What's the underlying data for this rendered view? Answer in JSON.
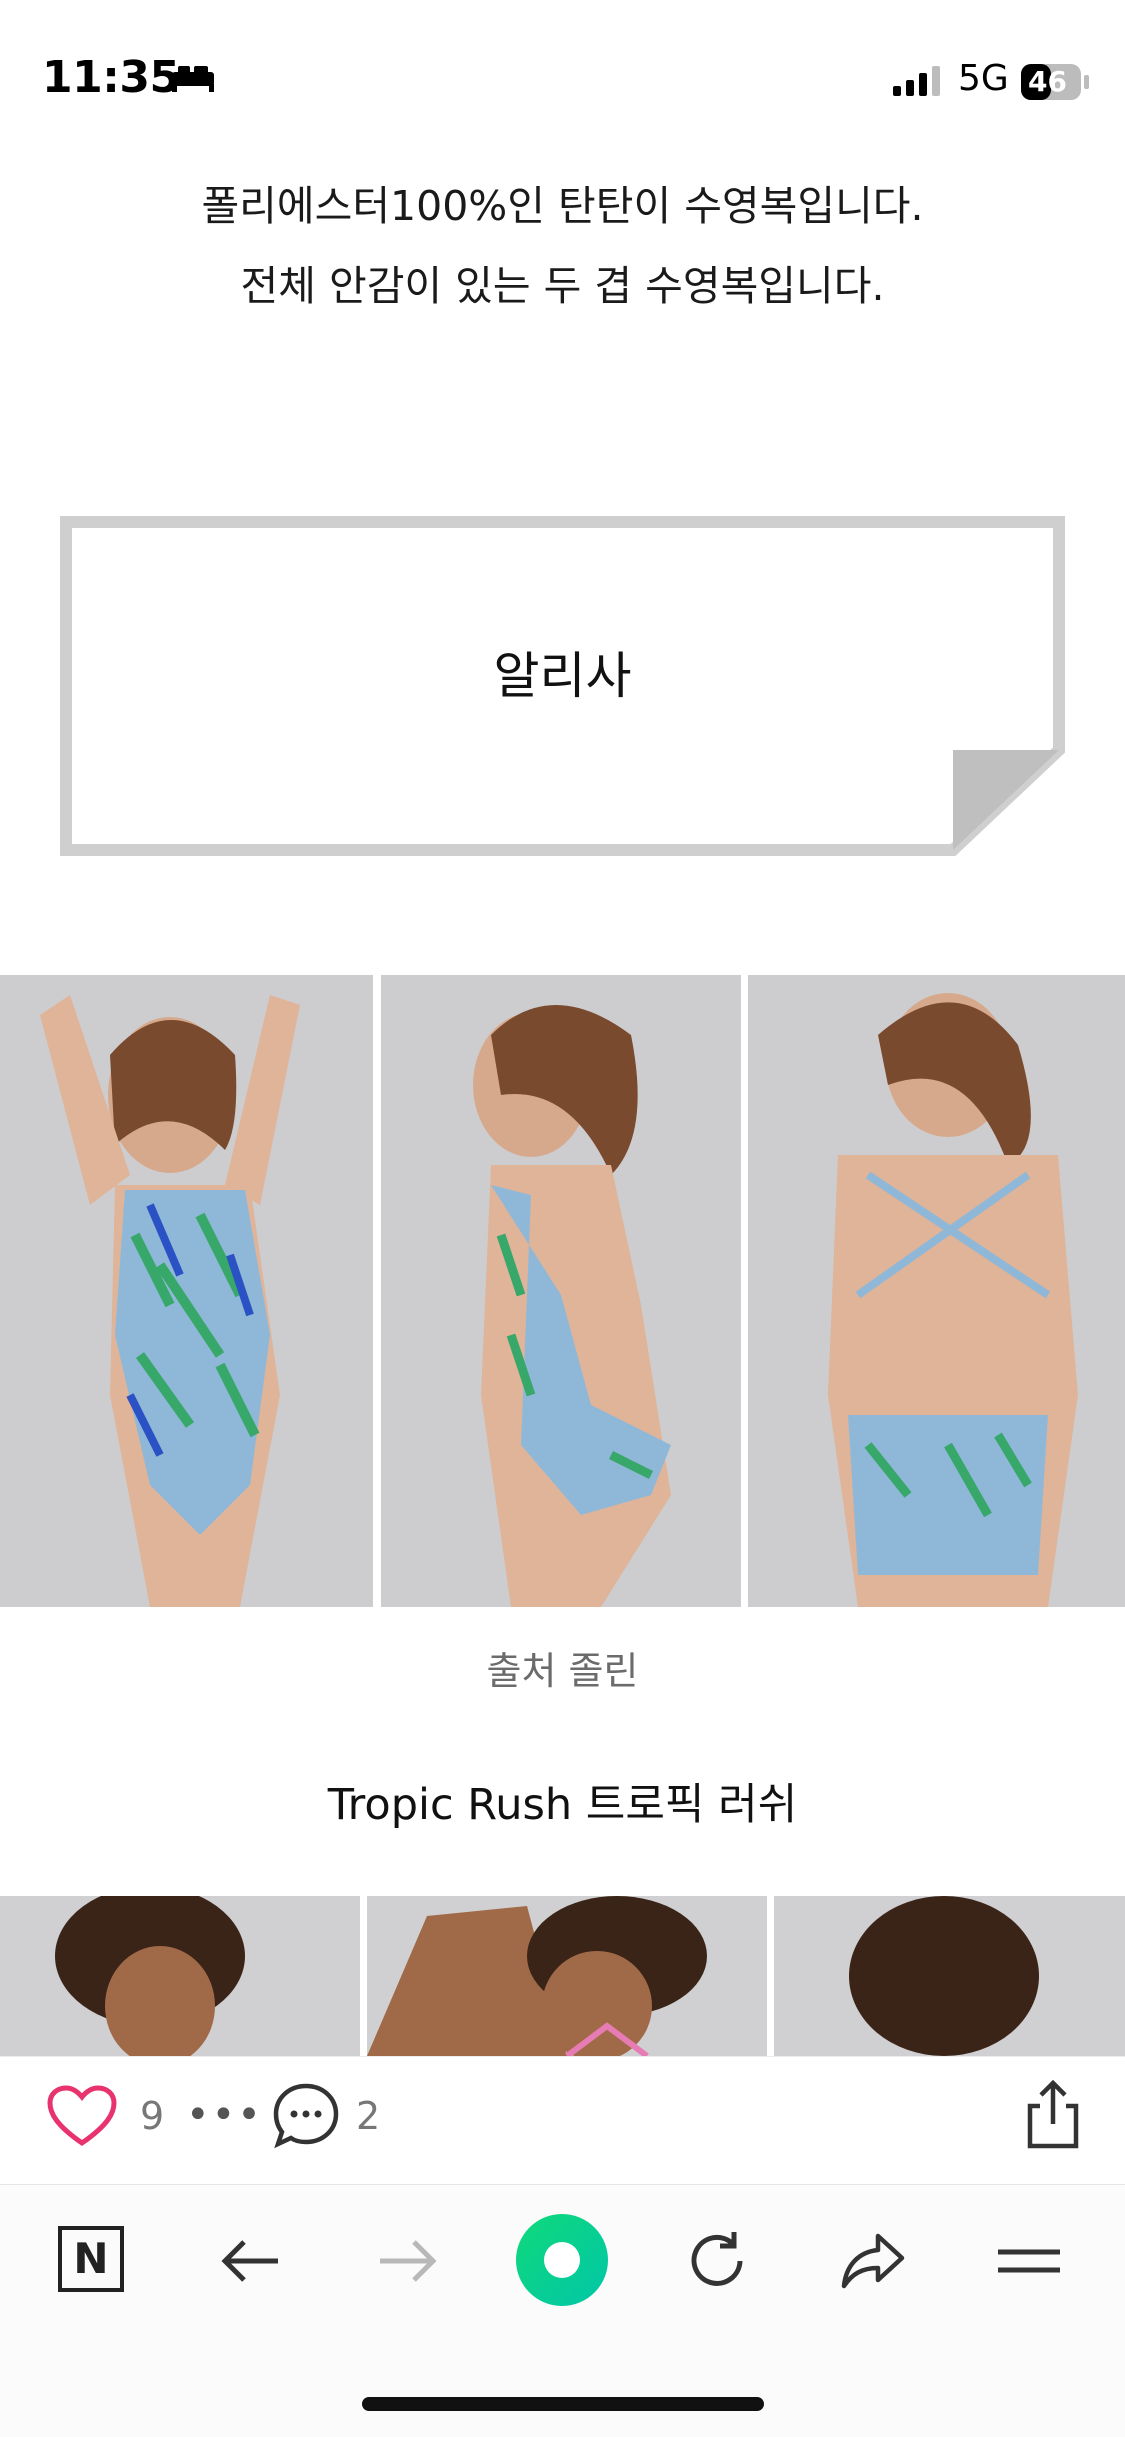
{
  "status_bar": {
    "time": "11:35",
    "network": "5G",
    "battery_level": "46"
  },
  "post": {
    "intro_line1": "폴리에스터100%인 탄탄이 수영복입니다.",
    "intro_line2": "전체 안감이 있는 두 겹 수영복입니다.",
    "note_label": "알리사",
    "photo_caption": "출처 졸린",
    "subtitle": "Tropic Rush 트로픽 러쉬"
  },
  "reactions": {
    "like_count": "9",
    "more": "•••",
    "comment_count": "2"
  },
  "toolbar": {
    "n_button": "N"
  },
  "colors": {
    "like_pink": "#e8336f",
    "home_green": "#10d97a",
    "note_border": "#cfcfcf"
  },
  "icons": [
    "bed-icon",
    "signal-icon",
    "battery-icon",
    "heart-icon",
    "comment-icon",
    "share-icon",
    "back-icon",
    "forward-icon",
    "home-icon",
    "reload-icon",
    "share-forward-icon",
    "menu-icon"
  ]
}
